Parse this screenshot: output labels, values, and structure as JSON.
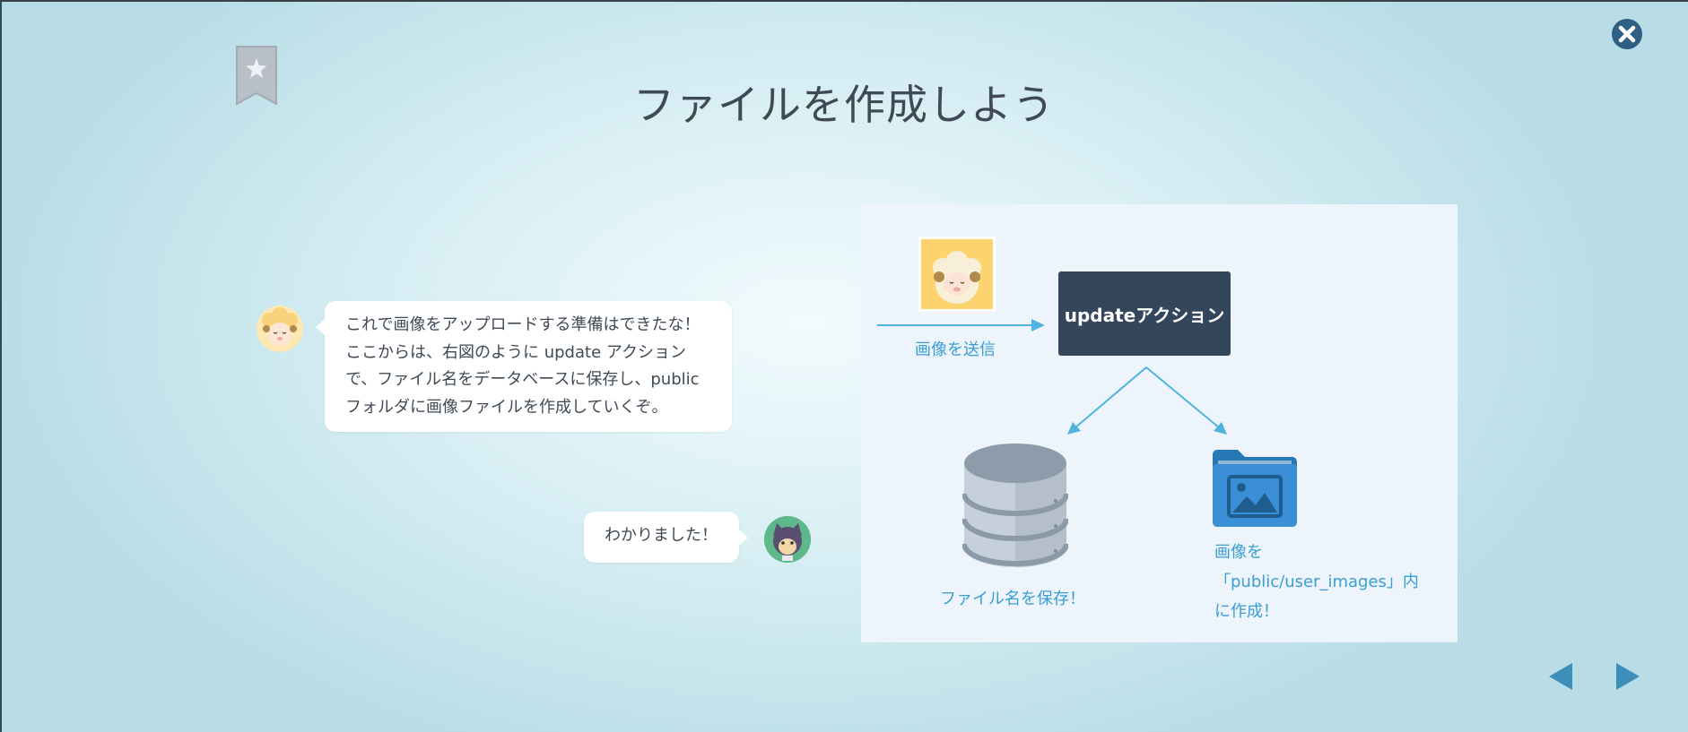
{
  "title": "ファイルを作成しよう",
  "icons": {
    "bookmark": "star-bookmark-icon",
    "close": "close-icon",
    "prev": "prev-arrow-icon",
    "next": "next-arrow-icon",
    "database": "database-icon",
    "folder": "image-folder-icon"
  },
  "chat": {
    "mentor_message": "これで画像をアップロードする準備はできたな！\nここからは、右図のように update アクションで、ファイル名をデータベースに保存し、public フォルダに画像ファイルを作成していくぞ。",
    "user_reply": "わかりました！"
  },
  "diagram": {
    "send_label": "画像を送信",
    "action_label": "updateアクション",
    "save_label": "ファイル名を保存！",
    "create_label": "画像を\n「public/user_images」内\nに作成！"
  },
  "colors": {
    "accent_blue": "#3a9ed3",
    "action_box": "#33465b",
    "title_text": "#3f4a55"
  }
}
